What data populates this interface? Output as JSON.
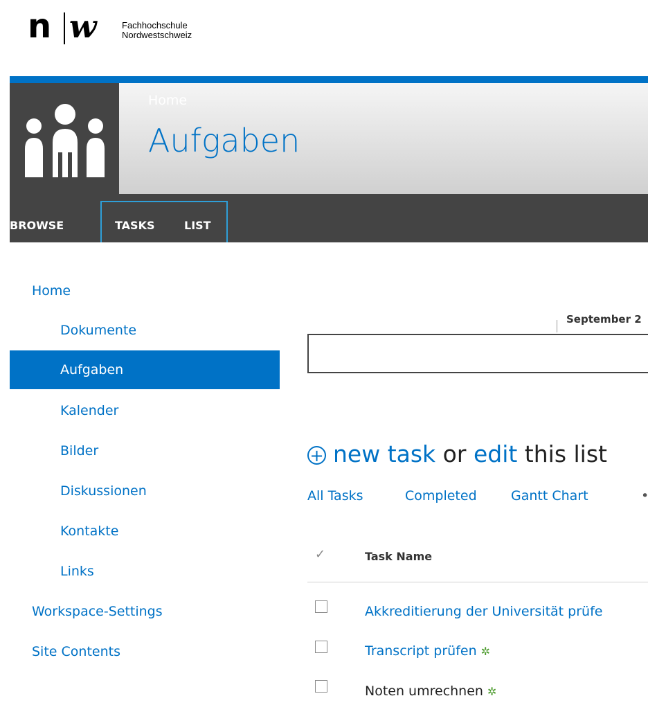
{
  "logo": {
    "line1": "Fachhochschule",
    "line2": "Nordwestschweiz"
  },
  "header": {
    "breadcrumb": "Home",
    "title": "Aufgaben",
    "accent": "#0072c6"
  },
  "ribbon": {
    "tabs": [
      "BROWSE",
      "TASKS",
      "LIST"
    ]
  },
  "nav": {
    "home": "Home",
    "items": [
      "Dokumente",
      "Aufgaben",
      "Kalender",
      "Bilder",
      "Diskussionen",
      "Kontakte",
      "Links"
    ],
    "workspace": "Workspace-Settings",
    "site_contents": "Site Contents"
  },
  "timeline": {
    "label": "September 2"
  },
  "toolbar": {
    "new_task": "new task",
    "or": "or",
    "edit": "edit",
    "this_list": "this list"
  },
  "views": {
    "items": [
      "All Tasks",
      "Completed",
      "Gantt Chart"
    ],
    "more": "••"
  },
  "table": {
    "header_check": "✓",
    "column": "Task Name",
    "rows": [
      {
        "name": "Akkreditierung der Universität prüfe"
      },
      {
        "name": "Transcript prüfen",
        "badge": "✲"
      },
      {
        "name": "Noten umrechnen",
        "badge": "✲"
      }
    ]
  }
}
